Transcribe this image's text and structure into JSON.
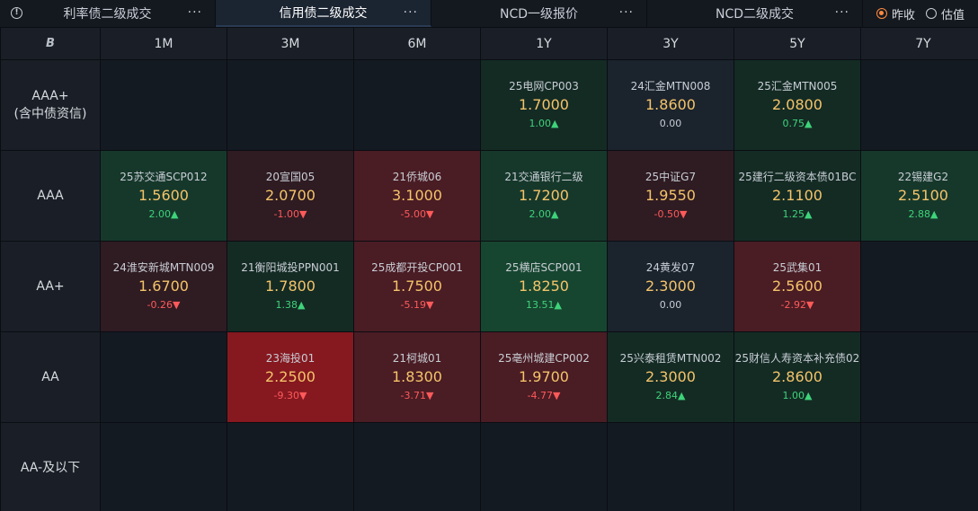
{
  "tabs": [
    {
      "label": "利率债二级成交",
      "more": "···"
    },
    {
      "label": "信用债二级成交",
      "more": "···",
      "active": true
    },
    {
      "label": "NCD一级报价",
      "more": "···"
    },
    {
      "label": "NCD二级成交",
      "more": "···"
    }
  ],
  "radio": {
    "option1": "昨收",
    "option2": "估值",
    "selected": "昨收"
  },
  "header": {
    "corner": "B",
    "columns": [
      "1M",
      "3M",
      "6M",
      "1Y",
      "3Y",
      "5Y",
      "7Y"
    ]
  },
  "rows": [
    {
      "label": "AAA+\n(含中债资信)",
      "cells": [
        null,
        null,
        null,
        {
          "name": "25电网CP003",
          "rate": "1.7000",
          "chg": "1.00▲",
          "dir": "up",
          "bg": "bg-g1"
        },
        {
          "name": "24汇金MTN008",
          "rate": "1.8600",
          "chg": "0.00",
          "dir": "flat",
          "bg": "bg-dark"
        },
        {
          "name": "25汇金MTN005",
          "rate": "2.0800",
          "chg": "0.75▲",
          "dir": "up",
          "bg": "bg-g1"
        },
        null
      ]
    },
    {
      "label": "AAA",
      "cells": [
        {
          "name": "25苏交通SCP012",
          "rate": "1.5600",
          "chg": "2.00▲",
          "dir": "up",
          "bg": "bg-g2"
        },
        {
          "name": "20宣国05",
          "rate": "2.0700",
          "chg": "-1.00▼",
          "dir": "down",
          "bg": "bg-r1"
        },
        {
          "name": "21侨城06",
          "rate": "3.1000",
          "chg": "-5.00▼",
          "dir": "down",
          "bg": "bg-r2"
        },
        {
          "name": "21交通银行二级",
          "rate": "1.7200",
          "chg": "2.00▲",
          "dir": "up",
          "bg": "bg-g2"
        },
        {
          "name": "25中证G7",
          "rate": "1.9550",
          "chg": "-0.50▼",
          "dir": "down",
          "bg": "bg-r1"
        },
        {
          "name": "25建行二级资本债01BC",
          "rate": "2.1100",
          "chg": "1.25▲",
          "dir": "up",
          "bg": "bg-g1"
        },
        {
          "name": "22锡建G2",
          "rate": "2.5100",
          "chg": "2.88▲",
          "dir": "up",
          "bg": "bg-g2"
        }
      ]
    },
    {
      "label": "AA+",
      "cells": [
        {
          "name": "24淮安新城MTN009",
          "rate": "1.6700",
          "chg": "-0.26▼",
          "dir": "down",
          "bg": "bg-r1"
        },
        {
          "name": "21衡阳城投PPN001",
          "rate": "1.7800",
          "chg": "1.38▲",
          "dir": "up",
          "bg": "bg-g1"
        },
        {
          "name": "25成都开投CP001",
          "rate": "1.7500",
          "chg": "-5.19▼",
          "dir": "down",
          "bg": "bg-r2"
        },
        {
          "name": "25横店SCP001",
          "rate": "1.8250",
          "chg": "13.51▲",
          "dir": "up",
          "bg": "bg-g3"
        },
        {
          "name": "24黄发07",
          "rate": "2.3000",
          "chg": "0.00",
          "dir": "flat",
          "bg": "bg-dark"
        },
        {
          "name": "25武集01",
          "rate": "2.5600",
          "chg": "-2.92▼",
          "dir": "down",
          "bg": "bg-r2"
        },
        null
      ]
    },
    {
      "label": "AA",
      "cells": [
        null,
        {
          "name": "23海投01",
          "rate": "2.2500",
          "chg": "-9.30▼",
          "dir": "down",
          "bg": "bg-r4"
        },
        {
          "name": "21柯城01",
          "rate": "1.8300",
          "chg": "-3.71▼",
          "dir": "down",
          "bg": "bg-r2"
        },
        {
          "name": "25亳州城建CP002",
          "rate": "1.9700",
          "chg": "-4.77▼",
          "dir": "down",
          "bg": "bg-r2"
        },
        {
          "name": "25兴泰租赁MTN002",
          "rate": "2.3000",
          "chg": "2.84▲",
          "dir": "up",
          "bg": "bg-g1"
        },
        {
          "name": "25财信人寿资本补充债02",
          "rate": "2.8600",
          "chg": "1.00▲",
          "dir": "up",
          "bg": "bg-g1"
        },
        null
      ]
    },
    {
      "label": "AA-及以下",
      "cells": [
        null,
        null,
        null,
        null,
        null,
        null,
        null
      ]
    }
  ]
}
